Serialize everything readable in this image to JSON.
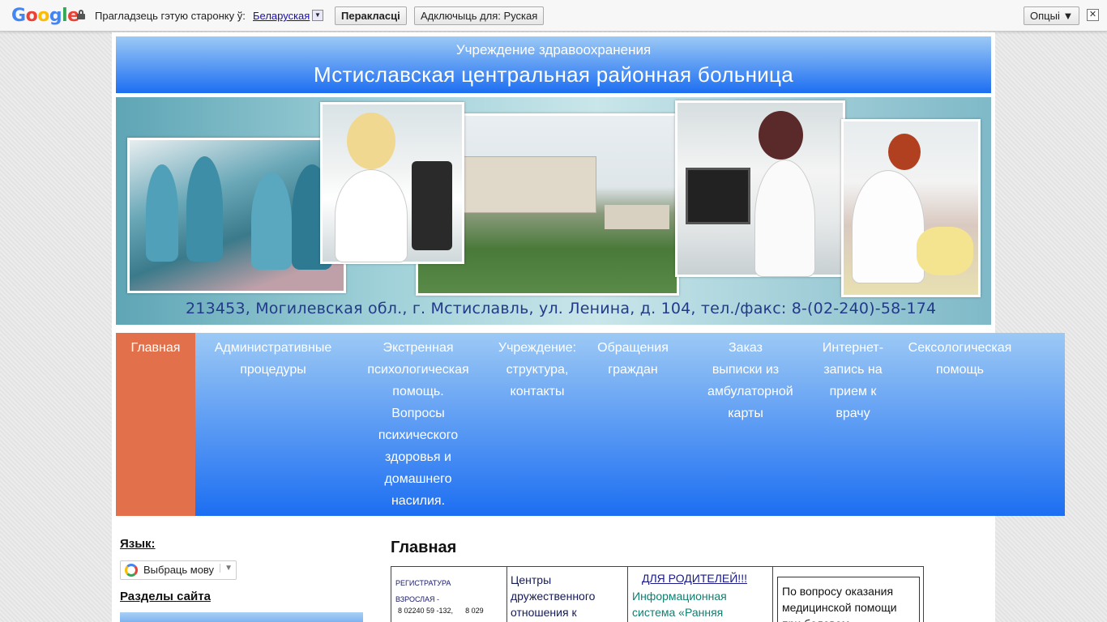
{
  "translate_bar": {
    "logo": "Google",
    "prompt": "Прагладзець гэтую старонку ў:",
    "language": "Беларуская",
    "translate_button": "Перакласці",
    "disable_button": "Адключыць для: Руская",
    "options_button": "Опцыі ▼",
    "close": "✕"
  },
  "header": {
    "subtitle": "Учреждение здравоохранения",
    "title": "Мстиславская центральная районная больница"
  },
  "banner": {
    "address": "213453, Могилевская обл., г. Мстиславль, ул. Ленина, д. 104, тел./факс: 8-(02-240)-58-174"
  },
  "nav": {
    "items": [
      {
        "label": "Главная"
      },
      {
        "label": "Административные процедуры"
      },
      {
        "label": "Экстренная психологическая помощь. Вопросы психического здоровья и домашнего насилия."
      },
      {
        "label": "Учреждение: структура, контакты"
      },
      {
        "label": "Обращения граждан"
      },
      {
        "label": "Заказ выписки из амбулаторной карты"
      },
      {
        "label": "Интернет-запись на прием к врачу"
      },
      {
        "label": "Сексологическая помощь"
      }
    ]
  },
  "sidebar": {
    "language_label": "Язык:",
    "language_select": "Выбраць мову",
    "sections_label": "Разделы сайта"
  },
  "main": {
    "title": "Главная",
    "col1_line1": "РЕГИСТРАТУРА",
    "col1_line2": "ВЗРОСЛАЯ -",
    "col1_line3": "8 02240 59 -132,",
    "col1_line4": "8 029",
    "col2_text": "Центры дружественного отношения к",
    "col3_title": "ДЛЯ РОДИТЕЛЕЙ!!!",
    "col3_text": "Информационная система «Ранняя",
    "col4_text": "По вопросу оказания медицинской помощи при болевом"
  },
  "colors": {
    "header_top": "#9cc9f5",
    "header_bottom": "#1c6ef2",
    "nav_active": "#e2704a",
    "address_text": "#233a8a"
  }
}
